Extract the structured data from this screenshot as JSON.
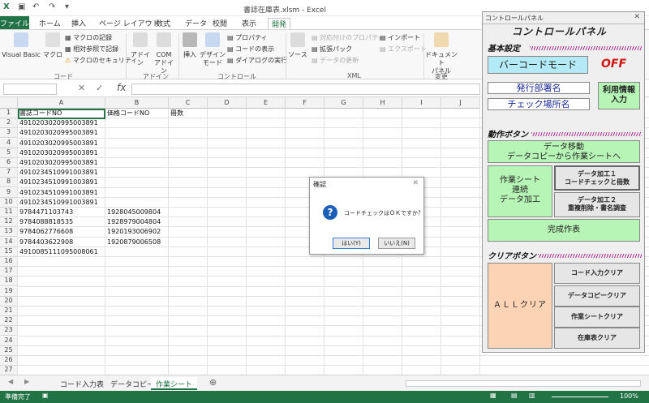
{
  "window": {
    "title": "書誌在庫表.xlsm - Excel"
  },
  "ribbon_tabs": [
    "ファイル",
    "ホーム",
    "挿入",
    "ページ レイアウト",
    "数式",
    "データ",
    "校閲",
    "表示",
    "開発"
  ],
  "ribbon": {
    "visual_basic": "Visual Basic",
    "macro": "マクロ",
    "record_macro": "マクロの記録",
    "relative_ref": "相対参照で記録",
    "macro_security": "マクロのセキュリティ",
    "addin": "アドイン",
    "com_addin_1": "COM",
    "com_addin_2": "アドイン",
    "insert": "挿入",
    "design_mode_1": "デザイン",
    "design_mode_2": "モード",
    "properties": "プロパティ",
    "view_code": "コードの表示",
    "run_dialog": "ダイアログの実行",
    "source": "ソース",
    "map_properties": "対応付けのプロパティ",
    "expansion_pack": "拡張パック",
    "refresh_data": "データの更新",
    "import": "インポート",
    "export": "エクスポート",
    "document_panel_1": "ドキュメント",
    "document_panel_2": "パネル",
    "groups": {
      "code": "コード",
      "addin": "アドイン",
      "control": "コントロール",
      "xml": "XML",
      "modify": "変更"
    }
  },
  "formula_bar": {
    "fx": "fx",
    "cancel": "✕",
    "enter": "✓"
  },
  "columns": [
    "A",
    "B",
    "C",
    "D",
    "E",
    "F",
    "G",
    "H",
    "I",
    "J"
  ],
  "rows": [
    [
      "書誌コードNO",
      "価格コードNO",
      "冊数"
    ],
    [
      "4910203020995003891",
      "",
      ""
    ],
    [
      "4910203020995003891",
      "",
      ""
    ],
    [
      "4910203020995003891",
      "",
      ""
    ],
    [
      "4910203020995003891",
      "",
      ""
    ],
    [
      "4910203020995003891",
      "",
      ""
    ],
    [
      "4910234510991003891",
      "",
      ""
    ],
    [
      "4910234510991003891",
      "",
      ""
    ],
    [
      "4910234510991003891",
      "",
      ""
    ],
    [
      "4910234510991003891",
      "",
      ""
    ],
    [
      "9784471103743",
      "1928045009804",
      ""
    ],
    [
      "9784088818535",
      "1928979004804",
      ""
    ],
    [
      "9784062776608",
      "1920193006902",
      ""
    ],
    [
      "9784403622908",
      "1920879006508",
      ""
    ],
    [
      "4910085111095008061",
      "",
      ""
    ],
    [
      "",
      "",
      ""
    ],
    [
      "",
      "",
      ""
    ],
    [
      "",
      "",
      ""
    ],
    [
      "",
      "",
      ""
    ],
    [
      "",
      "",
      ""
    ],
    [
      "",
      "",
      ""
    ],
    [
      "",
      "",
      ""
    ],
    [
      "",
      "",
      ""
    ],
    [
      "",
      "",
      ""
    ],
    [
      "",
      "",
      ""
    ],
    [
      "",
      "",
      ""
    ],
    [
      "",
      "",
      ""
    ]
  ],
  "sheet_tabs": [
    "コード入力表",
    "データコピー",
    "作業シート"
  ],
  "status": {
    "ready": "準備完了",
    "zoom": "100%"
  },
  "dialog": {
    "title": "確認",
    "message": "コードチェックはＯＫですか？",
    "yes": "はい(Y)",
    "no": "いいえ(N)"
  },
  "panel": {
    "window_title": "コントロールパネル",
    "title": "コントロールパネル",
    "basic": "基本設定",
    "barcode_mode": "バーコードモード",
    "off": "OFF",
    "dept": "発行部署名",
    "check_place": "チェック場所名",
    "user_info": "利用情報\n入力",
    "action": "動作ボタン",
    "data_move_1": "データ移動",
    "data_move_2": "データコピーから作業シートへ",
    "work_1": "作業シート",
    "work_2": "連続",
    "work_3": "データ加工",
    "proc1_1": "データ加工１",
    "proc1_2": "コードチェックと冊数",
    "proc2_1": "データ加工２",
    "proc2_2": "重複削除・書名調査",
    "complete": "完成作表",
    "clear": "クリアボタン",
    "all_clear": "ＡＬＬクリア",
    "code_clear": "コード入力クリア",
    "data_copy_clear": "データコピークリア",
    "work_clear": "作業シートクリア",
    "stock_clear": "在庫表クリア"
  },
  "colors": {
    "excel_green": "#217346",
    "panel_green": "#b6f5b6",
    "panel_cyan": "#b3eaf5",
    "panel_peach": "#fcd3b4",
    "off_red": "#d01515"
  }
}
